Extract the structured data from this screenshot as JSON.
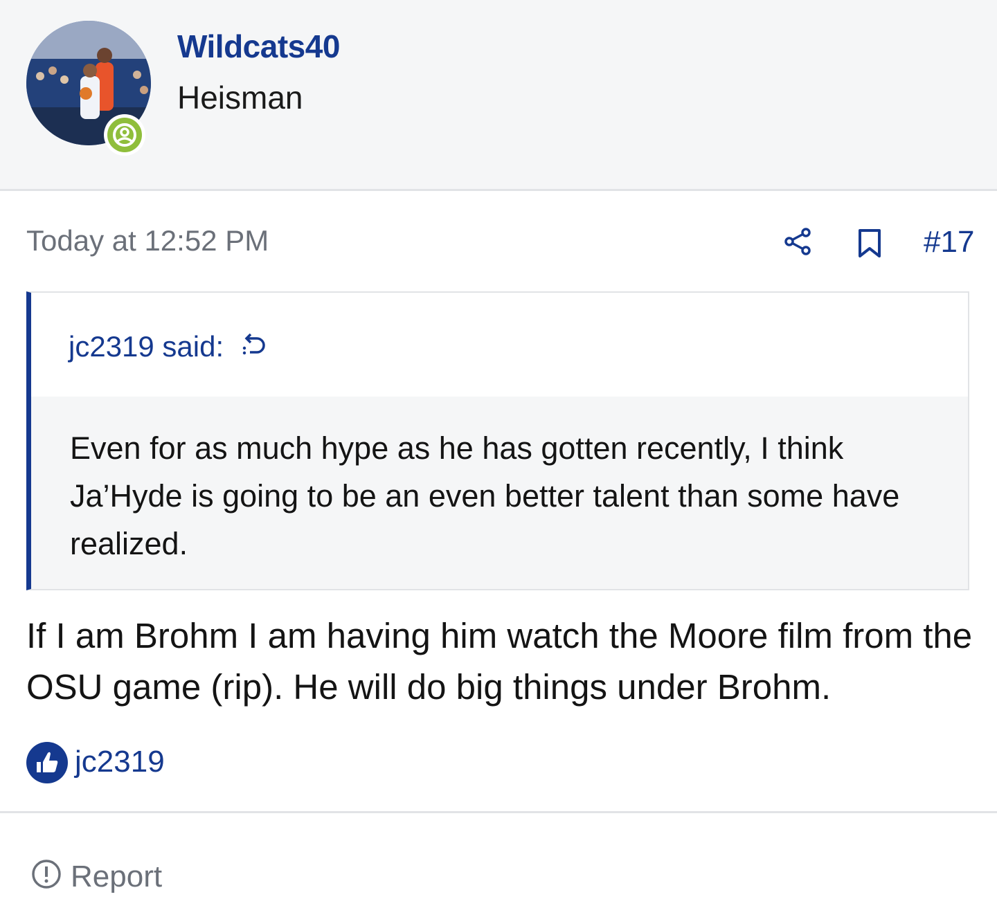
{
  "post": {
    "author": {
      "username": "Wildcats40",
      "title": "Heisman",
      "avatar_icon": "avatar-photo",
      "status_icon": "online-user-icon"
    },
    "date": "Today at 12:52 PM",
    "actions": {
      "share_icon": "share-icon",
      "bookmark_icon": "bookmark-icon",
      "post_number": "#17"
    },
    "quote": {
      "author_line": "jc2319 said:",
      "jump_icon": "jump-to-quote-icon",
      "text": "Even for as much hype as he has gotten recently, I think Ja’Hyde is going to be an even better talent than some have realized."
    },
    "message": "If I am Brohm I am having him watch the Moore film from the OSU game (rip). He will do big things under Brohm.",
    "reactions": {
      "icon": "thumbs-up-icon",
      "users": "jc2319"
    },
    "footer": {
      "report_label": "Report",
      "report_icon": "alert-circle-icon"
    }
  },
  "colors": {
    "accent": "#15398f",
    "header_bg": "#f5f6f7",
    "muted_text": "#6b7079",
    "online_badge": "#8fbe3b",
    "border": "#e1e3e6"
  }
}
